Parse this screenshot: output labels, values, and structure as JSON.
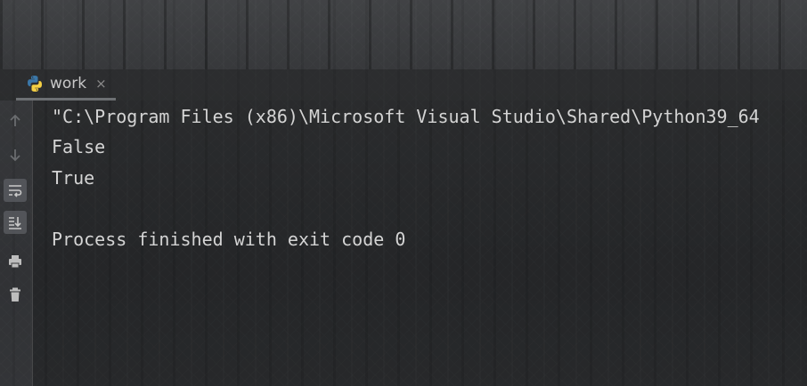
{
  "tab": {
    "label": "work",
    "icon": "python-icon",
    "close_glyph": "×"
  },
  "toolbar": {
    "buttons": [
      {
        "name": "scroll-up-icon",
        "enabled": false
      },
      {
        "name": "scroll-down-icon",
        "enabled": false
      },
      {
        "name": "soft-wrap-icon",
        "active": true
      },
      {
        "name": "scroll-to-end-icon",
        "active": true
      },
      {
        "name": "print-icon"
      },
      {
        "name": "trash-icon"
      }
    ]
  },
  "console": {
    "lines": [
      "\"C:\\Program Files (x86)\\Microsoft Visual Studio\\Shared\\Python39_64",
      "False",
      "True",
      "",
      "Process finished with exit code 0"
    ]
  },
  "colors": {
    "text": "#d4d4d4",
    "tab_underline": "#6d7073",
    "python_blue": "#3b77a8",
    "python_yellow": "#f4cf44"
  }
}
